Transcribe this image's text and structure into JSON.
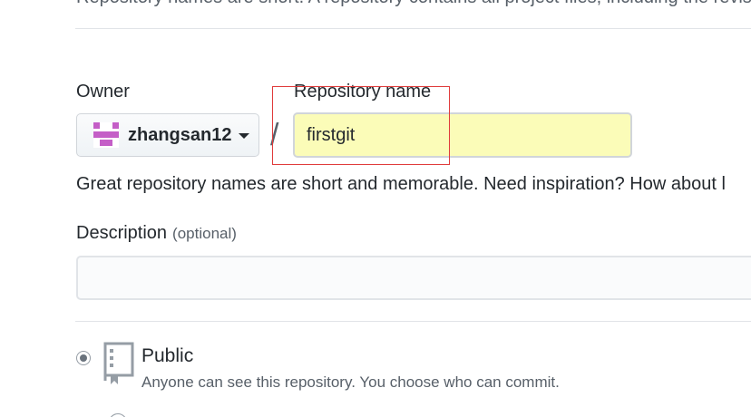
{
  "top_cut_text": "Repository names are short. A repository contains all project files, including the revision history.",
  "owner": {
    "label": "Owner",
    "selected": "zhangsan12",
    "avatar_color": "#c45ec7"
  },
  "repository_name": {
    "label": "Repository name",
    "value": "firstgit",
    "separator": "/",
    "highlight_color": "#e03b3b",
    "input_background": "#fbfcb8"
  },
  "hint_text": "Great repository names are short and memorable. Need inspiration? How about l",
  "description": {
    "label": "Description",
    "optional_label": "(optional)",
    "value": ""
  },
  "visibility": {
    "selected": "public",
    "options": [
      {
        "id": "public",
        "title": "Public",
        "description": "Anyone can see this repository. You choose who can commit.",
        "icon": "repo-book-icon"
      }
    ]
  }
}
